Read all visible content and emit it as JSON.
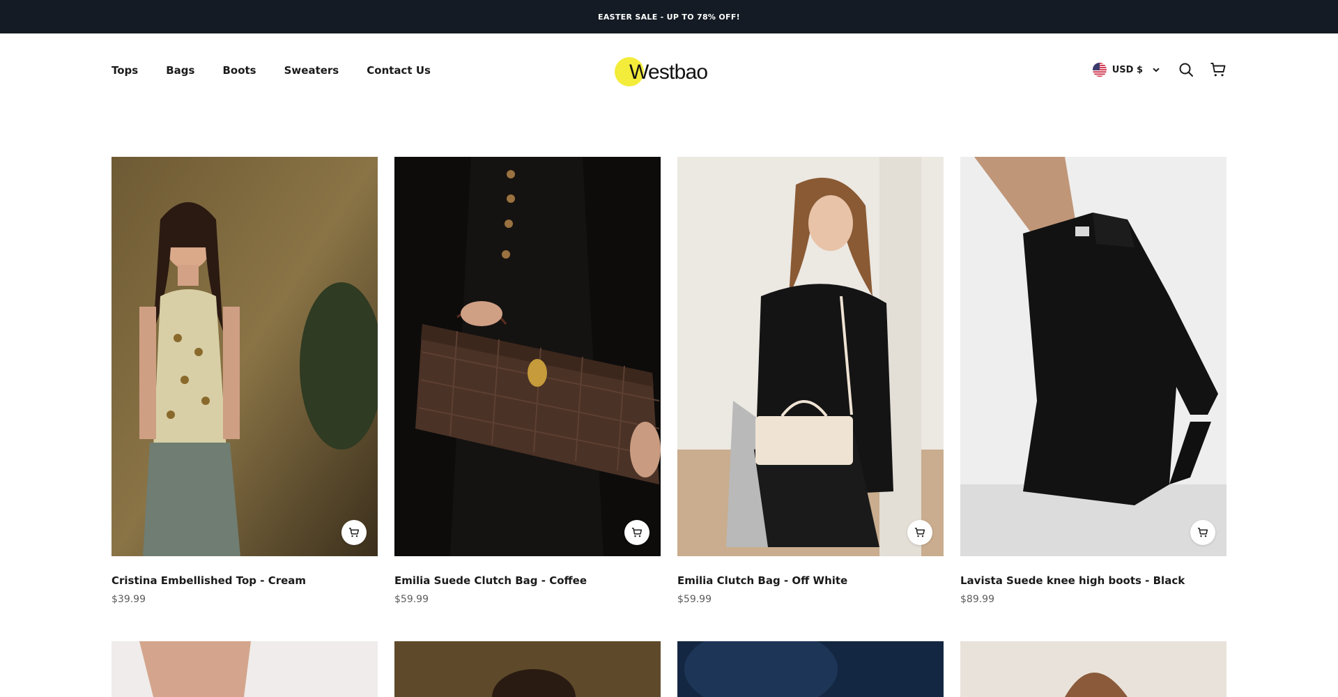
{
  "announcement": "EASTER SALE - UP TO 78% OFF!",
  "brand": {
    "name": "Westbao",
    "accent": "#f3ec3a"
  },
  "nav": [
    {
      "label": "Tops"
    },
    {
      "label": "Bags"
    },
    {
      "label": "Boots"
    },
    {
      "label": "Sweaters"
    },
    {
      "label": "Contact Us"
    }
  ],
  "currency": {
    "label": "USD $",
    "flag_icon": "us-flag-icon"
  },
  "icons": {
    "search": "search-icon",
    "cart": "cart-icon",
    "chevron": "chevron-down-icon",
    "quick_add": "quick-add-cart-icon"
  },
  "products": [
    {
      "name": "Cristina Embellished Top - Cream",
      "price": "$39.99"
    },
    {
      "name": "Emilia Suede Clutch Bag - Coffee",
      "price": "$59.99"
    },
    {
      "name": "Emilia Clutch Bag - Off White",
      "price": "$59.99"
    },
    {
      "name": "Lavista Suede knee high boots - Black",
      "price": "$89.99"
    }
  ],
  "colors": {
    "topbar": "#141b24",
    "text": "#1a1a1a",
    "price": "#5c5c5c"
  }
}
